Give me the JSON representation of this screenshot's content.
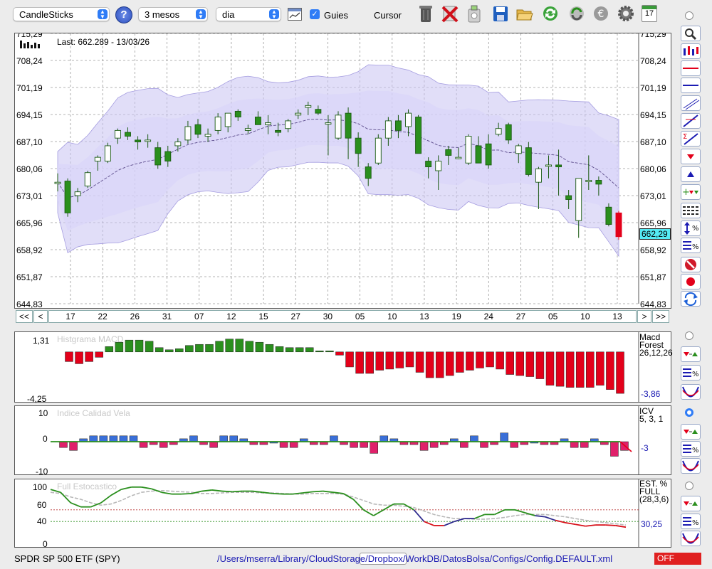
{
  "toolbar": {
    "chart_type": "CandleSticks",
    "period": "3 mesos",
    "interval": "dia",
    "guides_label": "Guies",
    "guides_checked": true,
    "cursor_label": "Cursor",
    "cursor_checked": false,
    "help_label": "?",
    "calendar_day": "17",
    "icons": [
      "trash-icon",
      "delete-icon",
      "clean-icon",
      "save-icon",
      "open-folder-icon",
      "refresh-icon",
      "sync-icon",
      "euro-icon",
      "settings-icon",
      "calendar-icon"
    ]
  },
  "main_chart": {
    "last_label": "Last: 662.289 - 13/03/26",
    "current_price": "662,29",
    "y_labels": [
      "715,29",
      "708,24",
      "701,19",
      "694,15",
      "687,10",
      "680,06",
      "673,01",
      "665,96",
      "658,92",
      "651,87",
      "644,83"
    ],
    "x_labels": [
      "17",
      "22",
      "26",
      "31",
      "07",
      "12",
      "15",
      "27",
      "30",
      "05",
      "10",
      "13",
      "19",
      "24",
      "27",
      "05",
      "10",
      "13"
    ],
    "nav": {
      "first": "<<",
      "prev": "<",
      "next": ">",
      "last": ">>"
    }
  },
  "macd": {
    "title": "Histgrama MACD",
    "top_value": "1,31",
    "bottom_value": "-4,25",
    "name_line1": "Macd",
    "name_line2": "Forest",
    "params": "26,12,26",
    "current": "-3,86"
  },
  "icv": {
    "title": "Indice Calidad Vela",
    "y_top": "10",
    "y_mid": "0",
    "y_bottom": "-10",
    "name": "ICV",
    "params": "5, 3, 1",
    "current": "-3"
  },
  "stoch": {
    "title": "Full Estocastico",
    "y_labels": [
      "100",
      "60",
      "40",
      "0"
    ],
    "name_line1": "EST. %",
    "name_line2": "FULL",
    "params": "(28,3,6)",
    "current": "30,25"
  },
  "status": {
    "symbol": "SPDR SP 500 ETF (SPY)",
    "path": "/Users/mserra/Library/CloudStorage/Dropbox/WorkDB/DatosBolsa/Configs/Config.DEFAULT.xml",
    "state": "OFF"
  },
  "colors": {
    "up": "#2a8f1d",
    "down": "#e3001a",
    "band": "#c9c3f2",
    "accent": "#1b1bb3",
    "macd_pos": "#2a8f1d",
    "macd_neg": "#e3001a",
    "icv_pos": "#3a6fd8",
    "icv_neg": "#e0206a"
  },
  "chart_data": [
    {
      "type": "candlestick",
      "title": "",
      "ylim": [
        644.83,
        715.29
      ],
      "candles": [
        {
          "o": 676.5,
          "h": 678.8,
          "l": 674.1,
          "c": 676.5
        },
        {
          "o": 676.8,
          "h": 677.5,
          "l": 667.5,
          "c": 668.5
        },
        {
          "o": 673.0,
          "h": 675.0,
          "l": 671.3,
          "c": 674.0
        },
        {
          "o": 675.5,
          "h": 679.5,
          "l": 675.0,
          "c": 679.0
        },
        {
          "o": 682.0,
          "h": 683.5,
          "l": 679.5,
          "c": 683.0
        },
        {
          "o": 682.0,
          "h": 686.8,
          "l": 681.5,
          "c": 686.0
        },
        {
          "o": 688.0,
          "h": 690.5,
          "l": 686.5,
          "c": 690.0
        },
        {
          "o": 689.5,
          "h": 690.8,
          "l": 687.5,
          "c": 688.5
        },
        {
          "o": 687.5,
          "h": 688.5,
          "l": 685.0,
          "c": 687.0
        },
        {
          "o": 687.5,
          "h": 689.0,
          "l": 685.5,
          "c": 687.5
        },
        {
          "o": 685.5,
          "h": 687.0,
          "l": 680.0,
          "c": 681.0
        },
        {
          "o": 684.5,
          "h": 686.0,
          "l": 680.5,
          "c": 682.0
        },
        {
          "o": 686.0,
          "h": 688.0,
          "l": 684.5,
          "c": 687.0
        },
        {
          "o": 687.5,
          "h": 692.5,
          "l": 686.5,
          "c": 691.0
        },
        {
          "o": 691.5,
          "h": 693.0,
          "l": 688.0,
          "c": 689.0
        },
        {
          "o": 688.5,
          "h": 690.5,
          "l": 687.0,
          "c": 689.0
        },
        {
          "o": 690.0,
          "h": 694.5,
          "l": 689.0,
          "c": 693.5
        },
        {
          "o": 691.0,
          "h": 694.5,
          "l": 689.5,
          "c": 694.5
        },
        {
          "o": 695.0,
          "h": 695.5,
          "l": 692.5,
          "c": 693.5
        },
        {
          "o": 690.0,
          "h": 691.5,
          "l": 689.0,
          "c": 690.5
        },
        {
          "o": 693.5,
          "h": 695.0,
          "l": 691.5,
          "c": 691.5
        },
        {
          "o": 691.5,
          "h": 694.0,
          "l": 689.0,
          "c": 692.0
        },
        {
          "o": 690.0,
          "h": 692.0,
          "l": 688.5,
          "c": 689.5
        },
        {
          "o": 690.5,
          "h": 693.0,
          "l": 689.5,
          "c": 692.5
        },
        {
          "o": 694.0,
          "h": 695.5,
          "l": 693.0,
          "c": 694.5
        },
        {
          "o": 696.0,
          "h": 697.5,
          "l": 694.0,
          "c": 696.5
        },
        {
          "o": 695.5,
          "h": 696.5,
          "l": 694.0,
          "c": 694.5
        },
        {
          "o": 692.0,
          "h": 694.0,
          "l": 683.5,
          "c": 692.0
        },
        {
          "o": 688.0,
          "h": 695.0,
          "l": 687.5,
          "c": 694.0
        },
        {
          "o": 694.5,
          "h": 696.0,
          "l": 682.5,
          "c": 688.0
        },
        {
          "o": 688.0,
          "h": 689.5,
          "l": 680.5,
          "c": 684.0
        },
        {
          "o": 680.5,
          "h": 681.5,
          "l": 675.5,
          "c": 677.5
        },
        {
          "o": 681.5,
          "h": 689.0,
          "l": 681.0,
          "c": 688.0
        },
        {
          "o": 688.0,
          "h": 693.5,
          "l": 686.0,
          "c": 692.5
        },
        {
          "o": 692.5,
          "h": 694.0,
          "l": 688.0,
          "c": 690.0
        },
        {
          "o": 691.0,
          "h": 695.5,
          "l": 688.5,
          "c": 694.5
        },
        {
          "o": 693.5,
          "h": 694.0,
          "l": 684.0,
          "c": 684.0
        },
        {
          "o": 682.0,
          "h": 683.0,
          "l": 677.5,
          "c": 680.5
        },
        {
          "o": 679.5,
          "h": 683.5,
          "l": 674.5,
          "c": 682.0
        },
        {
          "o": 685.0,
          "h": 686.0,
          "l": 681.0,
          "c": 683.5
        },
        {
          "o": 683.0,
          "h": 685.5,
          "l": 682.5,
          "c": 683.0
        },
        {
          "o": 681.5,
          "h": 689.0,
          "l": 681.0,
          "c": 688.5
        },
        {
          "o": 686.0,
          "h": 688.5,
          "l": 682.0,
          "c": 681.5
        },
        {
          "o": 686.5,
          "h": 689.0,
          "l": 680.0,
          "c": 681.0
        },
        {
          "o": 689.0,
          "h": 692.0,
          "l": 688.5,
          "c": 690.5
        },
        {
          "o": 691.5,
          "h": 692.0,
          "l": 686.5,
          "c": 687.5
        },
        {
          "o": 684.0,
          "h": 686.5,
          "l": 681.5,
          "c": 686.0
        },
        {
          "o": 685.5,
          "h": 687.0,
          "l": 678.0,
          "c": 678.5
        },
        {
          "o": 676.5,
          "h": 680.5,
          "l": 669.5,
          "c": 680.0
        },
        {
          "o": 681.0,
          "h": 683.5,
          "l": 677.5,
          "c": 681.0
        },
        {
          "o": 681.0,
          "h": 685.0,
          "l": 673.0,
          "c": 680.5
        },
        {
          "o": 673.0,
          "h": 674.5,
          "l": 669.5,
          "c": 672.0
        },
        {
          "o": 666.5,
          "h": 677.0,
          "l": 662.0,
          "c": 677.5
        },
        {
          "o": 677.0,
          "h": 683.5,
          "l": 674.5,
          "c": 677.0
        },
        {
          "o": 677.0,
          "h": 678.0,
          "l": 673.0,
          "c": 676.0
        },
        {
          "o": 670.0,
          "h": 671.0,
          "l": 665.0,
          "c": 665.5
        },
        {
          "o": 668.5,
          "h": 669.0,
          "l": 661.5,
          "c": 662.3
        }
      ]
    },
    {
      "type": "bar",
      "title": "Histgrama MACD",
      "ylim": [
        -4.25,
        1.31
      ],
      "values": [
        -0.9,
        -1.1,
        -0.9,
        -0.5,
        0.5,
        0.9,
        1.1,
        1.1,
        1.0,
        0.4,
        0.2,
        0.3,
        0.6,
        0.7,
        0.7,
        1.0,
        1.2,
        1.2,
        1.0,
        0.9,
        0.7,
        0.5,
        0.4,
        0.4,
        0.4,
        0.1,
        0.1,
        -0.3,
        -1.4,
        -2.0,
        -2.0,
        -1.7,
        -1.6,
        -1.5,
        -1.4,
        -1.9,
        -2.4,
        -2.4,
        -2.2,
        -1.9,
        -1.7,
        -1.5,
        -1.4,
        -1.6,
        -2.1,
        -2.2,
        -2.3,
        -2.5,
        -3.1,
        -3.2,
        -3.3,
        -3.3,
        -3.3,
        -3.1,
        -3.5,
        -3.86
      ]
    },
    {
      "type": "bar",
      "title": "Indice Calidad Vela",
      "ylim": [
        -10,
        10
      ],
      "values": [
        -2,
        -3,
        1,
        2,
        2,
        2,
        2,
        2,
        -2,
        -1,
        -2,
        -1,
        1,
        2,
        -1,
        -2,
        2,
        2,
        1,
        -1,
        -1,
        0,
        -2,
        -2,
        1,
        -1,
        -1,
        2,
        -1,
        -2,
        -2,
        -4,
        2,
        1,
        -1,
        -1,
        -3,
        -2,
        -1,
        1,
        -2,
        2,
        -2,
        -1,
        3,
        -2,
        -1,
        0,
        -1,
        -1,
        1,
        -2,
        -2,
        1,
        -1,
        -5,
        -3
      ]
    },
    {
      "type": "line",
      "title": "Full Estocastico",
      "ylim": [
        0,
        100
      ],
      "series": [
        {
          "values": [
            95,
            90,
            72,
            65,
            65,
            72,
            85,
            95,
            99,
            99,
            96,
            90,
            87,
            87,
            88,
            92,
            94,
            92,
            91,
            92,
            92,
            90,
            88,
            87,
            87,
            89,
            91,
            92,
            90,
            88,
            78,
            60,
            50,
            60,
            70,
            70,
            60,
            40,
            33,
            33,
            40,
            45,
            45,
            52,
            52,
            60,
            60,
            55,
            50,
            48,
            42,
            38,
            35,
            32,
            34,
            34,
            33,
            30.25
          ]
        },
        {
          "values": [
            90,
            88,
            82,
            78,
            72,
            68,
            70,
            76,
            84,
            90,
            92,
            93,
            92,
            91,
            90,
            88,
            88,
            89,
            90,
            90,
            90,
            89,
            89,
            88,
            87,
            87,
            88,
            88,
            88,
            87,
            82,
            76,
            70,
            68,
            68,
            66,
            64,
            58,
            52,
            48,
            45,
            45,
            44,
            44,
            45,
            47,
            50,
            52,
            52,
            52,
            50,
            48,
            45,
            42,
            40,
            38,
            36,
            34
          ]
        }
      ]
    }
  ]
}
